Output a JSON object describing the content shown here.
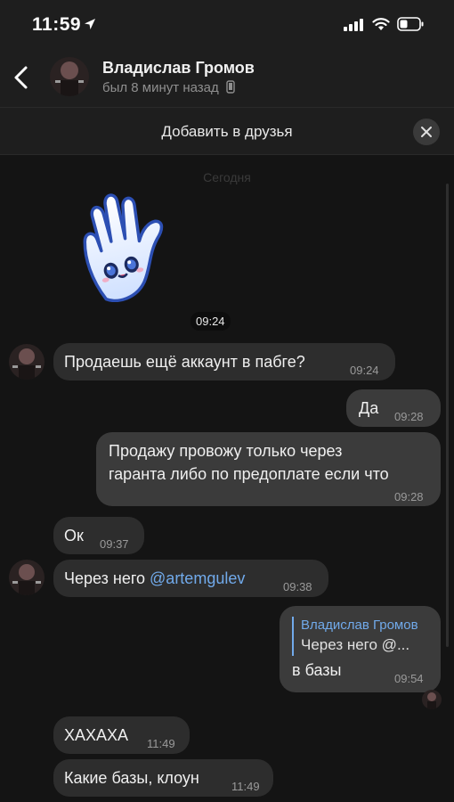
{
  "status_bar": {
    "time": "11:59"
  },
  "header": {
    "name": "Владислав Громов",
    "status": "был 8 минут назад"
  },
  "add_friend": {
    "label": "Добавить в друзья"
  },
  "chat": {
    "date_separator": "Сегодня",
    "sticker_time": "09:24",
    "messages": [
      {
        "text": "Продаешь ещё аккаунт в пабге?",
        "time": "09:24"
      },
      {
        "text": "Да",
        "time": "09:28"
      },
      {
        "text_line1": "Продажу провожу только через",
        "text_line2": "гаранта либо по предоплате если что",
        "time": "09:28"
      },
      {
        "text": "Ок",
        "time": "09:37"
      },
      {
        "text": "Через него ",
        "mention": "@artemgulev",
        "time": "09:38"
      },
      {
        "reply_name": "Владислав Громов",
        "reply_text": "Через него @...",
        "text": "в базы",
        "time": "09:54"
      },
      {
        "text": "ХАХАХА",
        "time": "11:49"
      },
      {
        "text": "Какие базы, клоун",
        "time": "11:49"
      }
    ]
  },
  "colors": {
    "background": "#141414",
    "bar": "#1e1e1e",
    "bubble_in": "#2d2d2d",
    "bubble_out": "#3b3b3b",
    "accent": "#71aaeb"
  },
  "icons": [
    "location-arrow-icon",
    "signal-icon",
    "wifi-icon",
    "battery-icon",
    "back-chevron-icon",
    "phone-icon",
    "close-icon"
  ]
}
